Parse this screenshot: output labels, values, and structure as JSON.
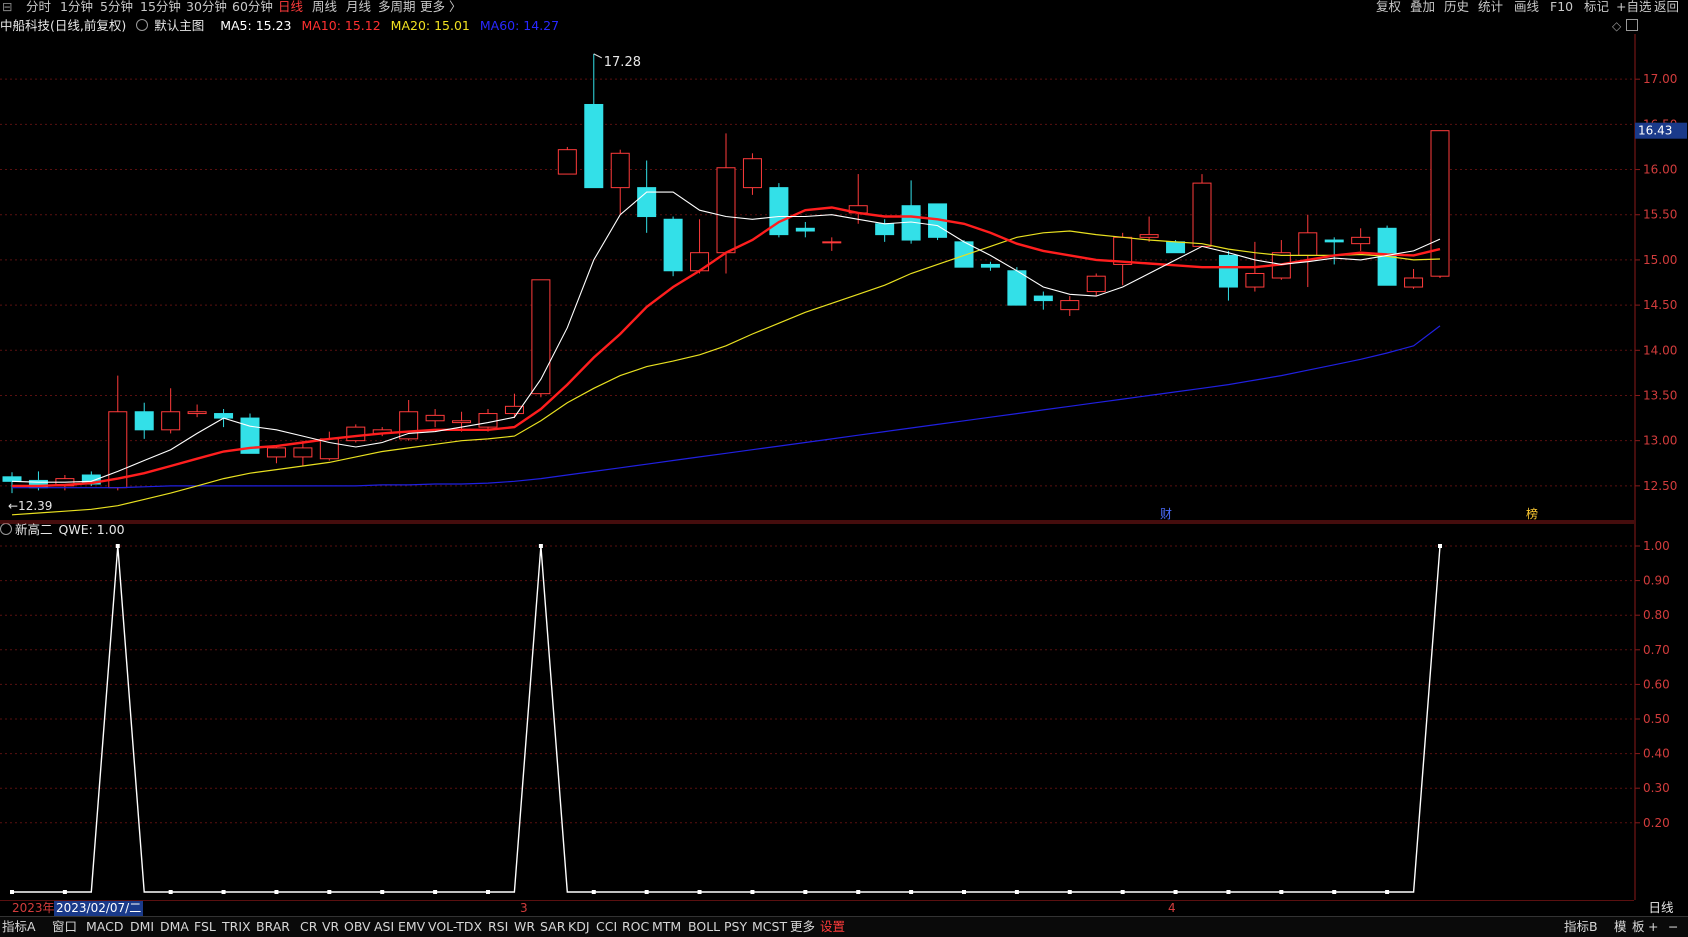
{
  "toolbar": {
    "items_left": [
      "分时",
      "1分钟",
      "5分钟",
      "15分钟",
      "30分钟",
      "60分钟",
      "日线",
      "周线",
      "月线",
      "多周期",
      "更多 〉"
    ],
    "active": "日线",
    "items_right": [
      "复权",
      "叠加",
      "历史",
      "统计",
      "画线",
      "F10",
      "标记",
      "+自选",
      "返回"
    ]
  },
  "info": {
    "stock": "中船科技(日线,前复权)",
    "main_chart": "默认主图",
    "ma5": "MA5: 15.23",
    "ma10": "MA10: 15.12",
    "ma20": "MA20: 15.01",
    "ma60": "MA60: 14.27"
  },
  "sub_info": {
    "indicator": "新高二",
    "value": "QWE: 1.00"
  },
  "price_axis": {
    "ticks": [
      "17.00",
      "16.50",
      "16.00",
      "15.50",
      "15.00",
      "14.50",
      "14.00",
      "13.50",
      "13.00",
      "12.50"
    ],
    "current": "16.43"
  },
  "sub_axis": {
    "ticks": [
      "1.00",
      "0.90",
      "0.80",
      "0.70",
      "0.60",
      "0.50",
      "0.40",
      "0.30",
      "0.20"
    ]
  },
  "annotations": {
    "high": "17.28",
    "low": "←12.39",
    "cai": "财",
    "bang": "榜"
  },
  "dates": {
    "year": "2023年",
    "cursor": "2023/02/07/二",
    "m3": "3",
    "m4": "4"
  },
  "period_label": "日线",
  "bottom": {
    "items": [
      "指标A",
      "窗口",
      "MACD",
      "DMI",
      "DMA",
      "FSL",
      "TRIX",
      "BRAR",
      "CR",
      "VR",
      "OBV",
      "ASI",
      "EMV",
      "VOL-TDX",
      "RSI",
      "WR",
      "SAR",
      "KDJ",
      "CCI",
      "ROC",
      "MTM",
      "BOLL",
      "PSY",
      "MCST",
      "更多",
      "设置"
    ],
    "right": [
      "指标B",
      "模",
      "板",
      "+",
      "−"
    ]
  },
  "colors": {
    "up": "#ff3b3b",
    "down": "#33e0e8",
    "ma5": "#ffffff",
    "ma10": "#ff1e1e",
    "ma20": "#e8e020",
    "ma60": "#2020e0",
    "grid": "#5a1010"
  },
  "chart_data": {
    "type": "candlestick",
    "y_range": [
      12.1,
      17.5
    ],
    "candles": [
      {
        "o": 12.6,
        "h": 12.65,
        "l": 12.42,
        "c": 12.55
      },
      {
        "o": 12.56,
        "h": 12.66,
        "l": 12.45,
        "c": 12.48
      },
      {
        "o": 12.5,
        "h": 12.62,
        "l": 12.45,
        "c": 12.58
      },
      {
        "o": 12.62,
        "h": 12.66,
        "l": 12.5,
        "c": 12.52
      },
      {
        "o": 12.48,
        "h": 13.72,
        "l": 12.45,
        "c": 13.32
      },
      {
        "o": 13.32,
        "h": 13.42,
        "l": 13.02,
        "c": 13.12
      },
      {
        "o": 13.12,
        "h": 13.58,
        "l": 13.08,
        "c": 13.32
      },
      {
        "o": 13.3,
        "h": 13.4,
        "l": 13.26,
        "c": 13.32
      },
      {
        "o": 13.3,
        "h": 13.35,
        "l": 13.15,
        "c": 13.25
      },
      {
        "o": 13.25,
        "h": 13.3,
        "l": 12.86,
        "c": 12.86
      },
      {
        "o": 12.82,
        "h": 12.95,
        "l": 12.75,
        "c": 12.92
      },
      {
        "o": 12.82,
        "h": 13.0,
        "l": 12.72,
        "c": 12.92
      },
      {
        "o": 12.8,
        "h": 13.1,
        "l": 12.78,
        "c": 13.02
      },
      {
        "o": 13.0,
        "h": 13.18,
        "l": 12.98,
        "c": 13.15
      },
      {
        "o": 13.08,
        "h": 13.15,
        "l": 13.05,
        "c": 13.12
      },
      {
        "o": 13.02,
        "h": 13.45,
        "l": 13.0,
        "c": 13.32
      },
      {
        "o": 13.22,
        "h": 13.35,
        "l": 13.15,
        "c": 13.28
      },
      {
        "o": 13.2,
        "h": 13.32,
        "l": 13.1,
        "c": 13.22
      },
      {
        "o": 13.15,
        "h": 13.35,
        "l": 13.1,
        "c": 13.3
      },
      {
        "o": 13.3,
        "h": 13.52,
        "l": 13.25,
        "c": 13.38
      },
      {
        "o": 13.52,
        "h": 14.78,
        "l": 13.48,
        "c": 14.78
      },
      {
        "o": 15.95,
        "h": 16.25,
        "l": 15.95,
        "c": 16.22
      },
      {
        "o": 16.72,
        "h": 17.28,
        "l": 15.8,
        "c": 15.8
      },
      {
        "o": 15.8,
        "h": 16.22,
        "l": 15.5,
        "c": 16.18
      },
      {
        "o": 15.8,
        "h": 16.1,
        "l": 15.3,
        "c": 15.48
      },
      {
        "o": 15.45,
        "h": 15.48,
        "l": 14.82,
        "c": 14.88
      },
      {
        "o": 14.88,
        "h": 15.45,
        "l": 14.85,
        "c": 15.08
      },
      {
        "o": 15.08,
        "h": 16.4,
        "l": 14.85,
        "c": 16.02
      },
      {
        "o": 15.8,
        "h": 16.18,
        "l": 15.72,
        "c": 16.12
      },
      {
        "o": 15.8,
        "h": 15.85,
        "l": 15.25,
        "c": 15.28
      },
      {
        "o": 15.35,
        "h": 15.42,
        "l": 15.25,
        "c": 15.32
      },
      {
        "o": 15.2,
        "h": 15.25,
        "l": 15.1,
        "c": 15.2
      },
      {
        "o": 15.52,
        "h": 15.95,
        "l": 15.4,
        "c": 15.6
      },
      {
        "o": 15.4,
        "h": 15.45,
        "l": 15.2,
        "c": 15.28
      },
      {
        "o": 15.6,
        "h": 15.88,
        "l": 15.18,
        "c": 15.22
      },
      {
        "o": 15.62,
        "h": 15.62,
        "l": 15.22,
        "c": 15.25
      },
      {
        "o": 15.2,
        "h": 15.22,
        "l": 14.92,
        "c": 14.92
      },
      {
        "o": 14.95,
        "h": 14.98,
        "l": 14.88,
        "c": 14.92
      },
      {
        "o": 14.88,
        "h": 14.92,
        "l": 14.5,
        "c": 14.5
      },
      {
        "o": 14.6,
        "h": 14.65,
        "l": 14.45,
        "c": 14.55
      },
      {
        "o": 14.45,
        "h": 14.6,
        "l": 14.38,
        "c": 14.55
      },
      {
        "o": 14.65,
        "h": 14.85,
        "l": 14.6,
        "c": 14.82
      },
      {
        "o": 14.95,
        "h": 15.3,
        "l": 14.72,
        "c": 15.25
      },
      {
        "o": 15.25,
        "h": 15.48,
        "l": 15.2,
        "c": 15.28
      },
      {
        "o": 15.2,
        "h": 15.22,
        "l": 15.08,
        "c": 15.08
      },
      {
        "o": 15.15,
        "h": 15.95,
        "l": 15.15,
        "c": 15.85
      },
      {
        "o": 15.05,
        "h": 15.1,
        "l": 14.55,
        "c": 14.7
      },
      {
        "o": 14.7,
        "h": 15.2,
        "l": 14.65,
        "c": 14.85
      },
      {
        "o": 14.8,
        "h": 15.22,
        "l": 14.78,
        "c": 15.08
      },
      {
        "o": 15.05,
        "h": 15.5,
        "l": 14.7,
        "c": 15.3
      },
      {
        "o": 15.22,
        "h": 15.25,
        "l": 14.95,
        "c": 15.2
      },
      {
        "o": 15.18,
        "h": 15.35,
        "l": 15.1,
        "c": 15.25
      },
      {
        "o": 15.35,
        "h": 15.38,
        "l": 14.72,
        "c": 14.72
      },
      {
        "o": 14.7,
        "h": 14.9,
        "l": 14.68,
        "c": 14.8
      },
      {
        "o": 14.82,
        "h": 16.43,
        "l": 14.8,
        "c": 16.43
      }
    ],
    "ma5": [
      12.55,
      12.54,
      12.54,
      12.55,
      12.66,
      12.78,
      12.9,
      13.08,
      13.25,
      13.16,
      13.12,
      13.05,
      12.98,
      12.93,
      12.98,
      13.08,
      13.1,
      13.15,
      13.2,
      13.26,
      13.68,
      14.25,
      15.0,
      15.5,
      15.75,
      15.75,
      15.55,
      15.48,
      15.45,
      15.48,
      15.48,
      15.5,
      15.45,
      15.4,
      15.42,
      15.38,
      15.2,
      15.05,
      14.88,
      14.7,
      14.62,
      14.6,
      14.7,
      14.85,
      15.0,
      15.15,
      15.08,
      15.0,
      14.95,
      14.98,
      15.02,
      15.0,
      15.05,
      15.1,
      15.23
    ],
    "ma10": [
      12.5,
      12.5,
      12.51,
      12.53,
      12.58,
      12.64,
      12.72,
      12.8,
      12.88,
      12.92,
      12.94,
      12.98,
      13.02,
      13.05,
      13.08,
      13.1,
      13.12,
      13.12,
      13.12,
      13.15,
      13.35,
      13.62,
      13.92,
      14.18,
      14.48,
      14.7,
      14.88,
      15.08,
      15.22,
      15.42,
      15.55,
      15.58,
      15.52,
      15.48,
      15.48,
      15.45,
      15.4,
      15.3,
      15.18,
      15.1,
      15.05,
      15.0,
      14.98,
      14.96,
      14.94,
      14.92,
      14.92,
      14.92,
      14.95,
      15.0,
      15.05,
      15.08,
      15.06,
      15.05,
      15.12
    ],
    "ma20": [
      12.18,
      12.2,
      12.22,
      12.24,
      12.28,
      12.35,
      12.42,
      12.5,
      12.58,
      12.64,
      12.68,
      12.72,
      12.76,
      12.82,
      12.88,
      12.92,
      12.96,
      13.0,
      13.02,
      13.05,
      13.22,
      13.42,
      13.58,
      13.72,
      13.82,
      13.88,
      13.95,
      14.05,
      14.18,
      14.3,
      14.42,
      14.52,
      14.62,
      14.72,
      14.85,
      14.95,
      15.05,
      15.15,
      15.25,
      15.3,
      15.32,
      15.28,
      15.25,
      15.22,
      15.2,
      15.18,
      15.12,
      15.08,
      15.05,
      15.05,
      15.05,
      15.06,
      15.04,
      15.0,
      15.01
    ],
    "ma60": [
      12.48,
      12.48,
      12.48,
      12.48,
      12.48,
      12.49,
      12.5,
      12.5,
      12.5,
      12.5,
      12.5,
      12.5,
      12.5,
      12.5,
      12.51,
      12.51,
      12.52,
      12.52,
      12.53,
      12.55,
      12.58,
      12.62,
      12.66,
      12.7,
      12.74,
      12.78,
      12.82,
      12.86,
      12.9,
      12.94,
      12.98,
      13.02,
      13.06,
      13.1,
      13.14,
      13.18,
      13.22,
      13.26,
      13.3,
      13.34,
      13.38,
      13.42,
      13.46,
      13.5,
      13.54,
      13.58,
      13.62,
      13.67,
      13.72,
      13.78,
      13.84,
      13.9,
      13.97,
      14.05,
      14.27
    ],
    "sub": {
      "name": "QWE",
      "y_range": [
        0,
        1
      ],
      "values": [
        0,
        0,
        0,
        0,
        1,
        0,
        0,
        0,
        0,
        0,
        0,
        0,
        0,
        0,
        0,
        0,
        0,
        0,
        0,
        0,
        1,
        0,
        0,
        0,
        0,
        0,
        0,
        0,
        0,
        0,
        0,
        0,
        0,
        0,
        0,
        0,
        0,
        0,
        0,
        0,
        0,
        0,
        0,
        0,
        0,
        0,
        0,
        0,
        0,
        0,
        0,
        0,
        0,
        0,
        1
      ]
    }
  }
}
